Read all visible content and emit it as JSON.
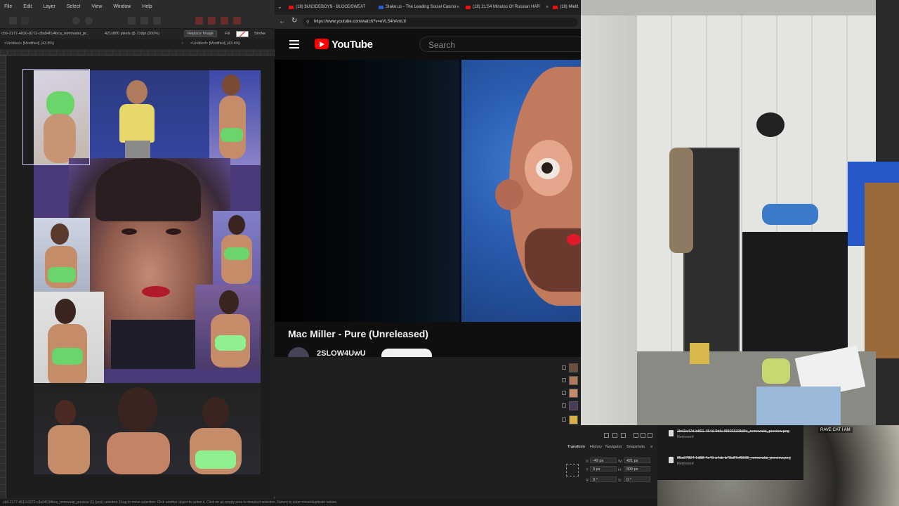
{
  "editor": {
    "menu": [
      "File",
      "Edit",
      "Layer",
      "Select",
      "View",
      "Window",
      "Help"
    ],
    "context": {
      "doc_id": "cb9-2177-4810-8272-c8a94f1f4bca_removalai_pr...",
      "doc_info": "421x800 pixels @ 72dpi (100%)",
      "replace_image": "Replace Image",
      "fill_label": "Fill",
      "stroke_label": "Stroke"
    },
    "doc_tabs": [
      "<Untitled> [Modified] (43.8%)",
      "<Untitled> [Modified] (43.4%)"
    ],
    "status": "cb9-2177-4810-8272-c8a94f1f4bca_removalai_preview (1) (pos) selected. Drag to move selection. Click another object to select it. Click on an empty area to deselect selection. Return to enter move/duplicate values."
  },
  "browser": {
    "tabs": [
      {
        "label": "(18) $UICIDEBOY$ - BLOODSWEAT",
        "favicon": "youtube-icon"
      },
      {
        "label": "Stake.us - The Leading Social Casino",
        "favicon": "stake-icon"
      },
      {
        "label": "(18) 21:54 Minutes Of Russian HAR",
        "favicon": "youtube-icon"
      },
      {
        "label": "(18) Mielit",
        "favicon": "youtube-icon"
      }
    ],
    "url": "https://www.youtube.com/watch?v=eVLS4hAmLtI",
    "yt_wordmark": "YouTube",
    "search_placeholder": "Search",
    "video_title": "Mac Miller - Pure (Unreleased)",
    "channel_name": "2SLOW4UwU"
  },
  "panel": {
    "tabs": [
      "Transform",
      "History",
      "Navigator",
      "Snapshots"
    ],
    "transform": {
      "x_label": "X:",
      "x_value": "-49 px",
      "y_label": "Y:",
      "y_value": "0 px",
      "w_label": "W:",
      "w_value": "421 px",
      "h_label": "H:",
      "h_value": "800 px",
      "r_label": "R:",
      "r_value": "0 °",
      "s_label": "S:",
      "s_value": "0 °"
    }
  },
  "notifications": [
    {
      "file": "1bd3a47d-b861-454d-9bfe-f8806533b8fe_removalai_preview.png",
      "status": "Removed"
    },
    {
      "file": "95a97804-1d88-4c49-a4cb-b73c87cf5595_removalai_preview.png",
      "status": "Removed"
    }
  ],
  "overlay_label": "RAVE CAT I AM"
}
